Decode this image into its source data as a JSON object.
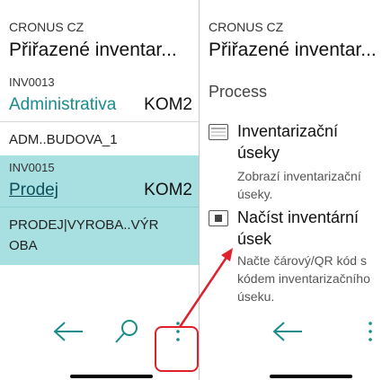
{
  "left": {
    "company": "CRONUS CZ",
    "title": "Přiřazené inventar...",
    "records": [
      {
        "no": "INV0013",
        "name": "Administrativa",
        "location": "KOM2",
        "description": "ADM..BUDOVA_1"
      },
      {
        "no": "INV0015",
        "name": "Prodej",
        "location": "KOM2",
        "description": "PRODEJ|VYROBA..VÝR OBA"
      }
    ],
    "nav": {
      "back_icon": "arrow-left-icon",
      "search_icon": "search-icon",
      "more_icon": "more-vertical-icon"
    }
  },
  "right": {
    "company": "CRONUS CZ",
    "title": "Přiřazené inventar...",
    "section": "Process",
    "actions": [
      {
        "label": "Inventarizační úseky",
        "description": "Zobrazí inventarizační úseky.",
        "icon": "list-icon"
      },
      {
        "label": "Načíst inventární úsek",
        "description": "Načte čárový/QR kód s kódem inventarizačního úseku.",
        "icon": "scan-icon"
      }
    ],
    "nav": {
      "back_icon": "arrow-left-icon",
      "more_icon": "more-vertical-icon"
    }
  },
  "colors": {
    "accent": "#1a8b8b",
    "selected_row": "#a8dfe0",
    "annotation": "#e0202a"
  }
}
